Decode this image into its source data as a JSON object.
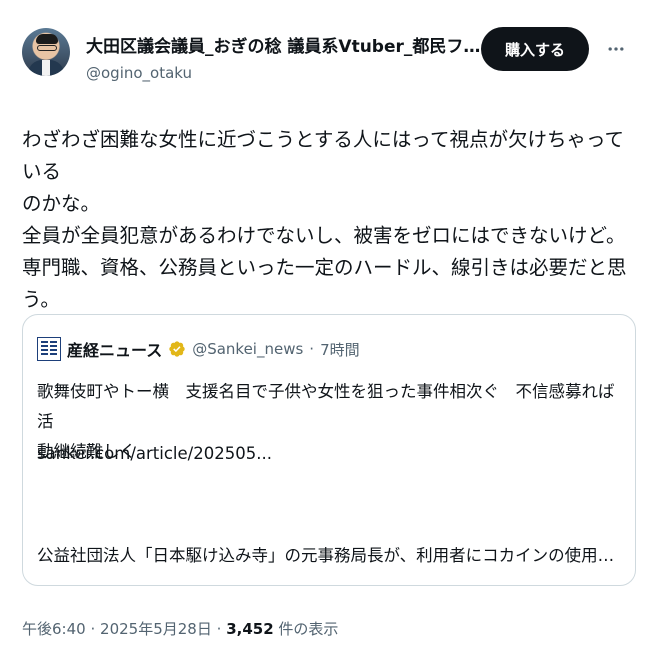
{
  "post": {
    "display_name": "大田区議会議員_おぎの稔 議員系Vtuber_都民ファー...",
    "handle": "@ogino_otaku",
    "buy_label": "購入する",
    "more_icon": "more-horizontal-icon",
    "body_lines": [
      "わざわざ困難な女性に近づこうとする人にはって視点が欠けちゃっている",
      "のかな。",
      "全員が全員犯意があるわけでないし、被害をゼロにはできないけど。",
      "専門職、資格、公務員といった一定のハードル、線引きは必要だと思う。"
    ]
  },
  "quote": {
    "name": "産経ニュース",
    "handle": "@Sankei_news",
    "separator": "·",
    "time": "7時間",
    "text_lines": [
      "歌舞伎町やトー横　支援名目で子供や女性を狙った事件相次ぐ　不信感募れば活",
      "動継続難しく"
    ],
    "link": "sankei.com/article/202505...",
    "text2": "公益社団法人「日本駆け込み寺」の元事務局長が、利用者にコカインの使用を..."
  },
  "meta": {
    "time": "午後6:40",
    "sep1": "·",
    "date": "2025年5月28日",
    "sep2": "·",
    "views": "3,452",
    "views_label": "件の表示"
  },
  "colors": {
    "text": "#0f1419",
    "secondary": "#536471",
    "verified_blue": "#1d9bf0",
    "verified_gold": "#e2b719",
    "border": "#cfd9de"
  }
}
